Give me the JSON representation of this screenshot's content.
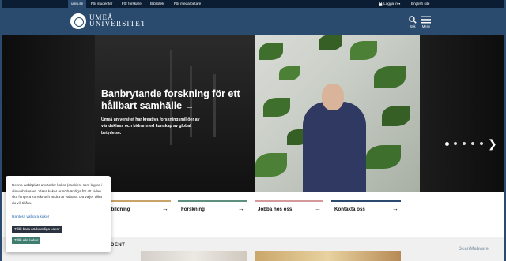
{
  "topbar": {
    "tabs": [
      {
        "label": "umu.se",
        "active": true
      },
      {
        "label": "För studenter",
        "active": false
      },
      {
        "label": "För forskare",
        "active": false
      },
      {
        "label": "Bibliotek",
        "active": false
      },
      {
        "label": "För medarbetare",
        "active": false
      }
    ],
    "login_label": "Logga in",
    "login_icon": "lock-icon",
    "language_label": "English site"
  },
  "header": {
    "logo_line1": "UMEÅ",
    "logo_line2": "UNIVERSITET",
    "search_label": "Sök",
    "menu_label": "Meny"
  },
  "hero": {
    "title": "Banbrytande forskning för ett hållbart samhälle",
    "body": "Umeå universitet har kreativa forskningsmiljöer av världsklass och bidrar med kunskap av global betydelse.",
    "slide_count": 5,
    "active_slide": 1
  },
  "quick_links": [
    {
      "label": "Utbildning",
      "color": "#c9a46a"
    },
    {
      "label": "Forskning",
      "color": "#5f8f7d"
    },
    {
      "label": "Jobba hos oss",
      "color": "#d49a9a"
    },
    {
      "label": "Kontakta oss",
      "color": "#2a4b6e"
    }
  ],
  "lower": {
    "section_label": "DENT"
  },
  "cookie": {
    "text": "Denna webbplats använder kakor (cookies) som lagras i din webbläsare. Vissa kakor är nödvändiga för att sidan ska fungera korrekt och andra är valbara. Du väljer vilka du vill tillåta.",
    "manage_link": "Hantera valbara kakor",
    "necessary_button": "Tillåt bara nödvändiga kakor",
    "all_button": "Tillåt alla kakor"
  },
  "watermark": "ScanMalware",
  "colors": {
    "topbar": "#0b1d33",
    "header": "#2a4b6e",
    "necessary_button": "#2b3340",
    "all_button": "#3f7e6f"
  }
}
